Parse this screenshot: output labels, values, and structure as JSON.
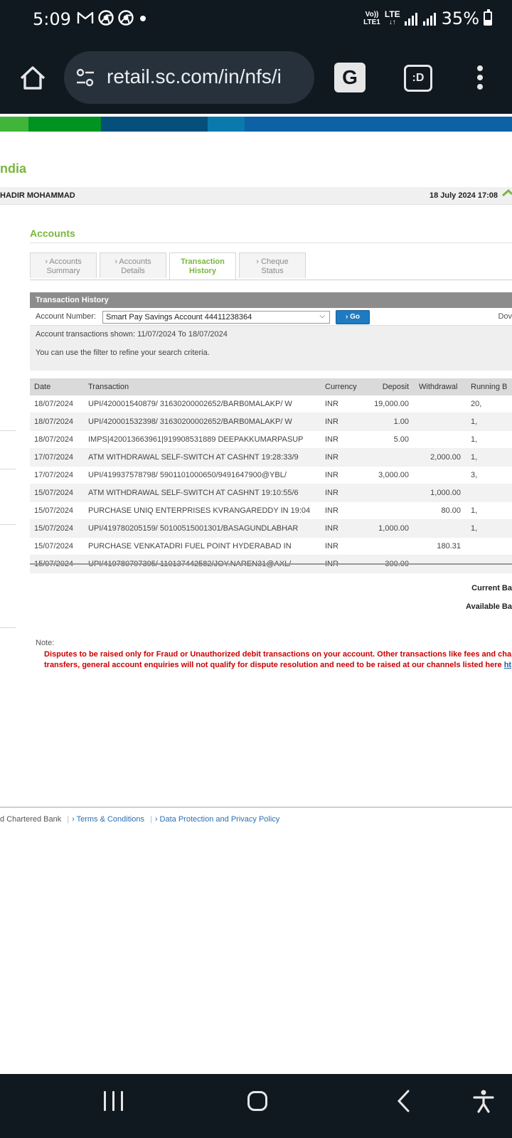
{
  "status_bar": {
    "time": "5:09",
    "network_top": "Vo))",
    "network_bottom": "LTE1",
    "lte_label": "LTE",
    "battery": "35%"
  },
  "browser": {
    "url": "retail.sc.com/in/nfs/i",
    "extension_label": ":D"
  },
  "colors": {
    "strip": [
      "#40b53a",
      "#009322",
      "#05507a",
      "#0a7aad",
      "#0c62a5"
    ],
    "accent_green": "#7ab63e",
    "note_red": "#cc0000"
  },
  "page": {
    "brand": "ndia",
    "user_name": "HADIR MOHAMMAD",
    "datetime": "18 July 2024 17:08",
    "section_title": "Accounts",
    "tabs": [
      {
        "line1": "› Accounts",
        "line2": "Summary"
      },
      {
        "line1": "› Accounts",
        "line2": "Details"
      },
      {
        "line1": "Transaction",
        "line2": "History"
      },
      {
        "line1": "› Cheque",
        "line2": "Status"
      }
    ],
    "panel_title": "Transaction History",
    "filter": {
      "account_label": "Account Number:",
      "account_value": "Smart Pay Savings Account 44411238364",
      "go_label": "› Go",
      "download_label": "Dov",
      "shown_text": "Account transactions shown: 11/07/2024 To 18/07/2024",
      "hint_text": "You can use the filter to refine your search criteria."
    },
    "table": {
      "headers": [
        "Date",
        "Transaction",
        "Currency",
        "Deposit",
        "Withdrawal",
        "Running B"
      ],
      "rows": [
        [
          "18/07/2024",
          "UPI/420001540879/ 31630200002652/BARB0MALAKP/ W",
          "INR",
          "19,000.00",
          "",
          "20,"
        ],
        [
          "18/07/2024",
          "UPI/420001532398/ 31630200002652/BARB0MALAKP/ W",
          "INR",
          "1.00",
          "",
          "1,"
        ],
        [
          "18/07/2024",
          "IMPS|420013663961|919908531889 DEEPAKKUMARPASUP",
          "INR",
          "5.00",
          "",
          "1,"
        ],
        [
          "17/07/2024",
          "ATM WITHDRAWAL SELF-SWITCH AT CASHNT 19:28:33/9",
          "INR",
          "",
          "2,000.00",
          "1,"
        ],
        [
          "17/07/2024",
          "UPI/419937578798/ 5901101000650/9491647900@YBL/",
          "INR",
          "3,000.00",
          "",
          "3,"
        ],
        [
          "15/07/2024",
          "ATM WITHDRAWAL SELF-SWITCH AT CASHNT 19:10:55/6",
          "INR",
          "",
          "1,000.00",
          ""
        ],
        [
          "15/07/2024",
          "PURCHASE UNIQ ENTERPRISES KVRANGAREDDY IN 19:04",
          "INR",
          "",
          "80.00",
          "1,"
        ],
        [
          "15/07/2024",
          "UPI/419780205159/ 50100515001301/BASAGUNDLABHAR",
          "INR",
          "1,000.00",
          "",
          "1,"
        ],
        [
          "15/07/2024",
          "PURCHASE VENKATADRI FUEL POINT HYDERABAD IN",
          "INR",
          "",
          "180.31",
          ""
        ],
        [
          "15/07/2024",
          "UPI/419780797395/ 110137442582/JOY.NAREN31@AXL/",
          "INR",
          "300.00",
          "",
          ""
        ]
      ]
    },
    "current_balance_label": "Current Ba",
    "available_balance_label": "Available Ba",
    "note_label": "Note:",
    "note_line1": "Disputes to be raised only for Fraud or Unauthorized debit transactions on your account. Other transactions like fees and cha",
    "note_line2": "transfers, general account enquiries will not qualify for dispute resolution and need to be raised at our channels listed here ",
    "note_link": "ht",
    "footer": {
      "bank": "d Chartered Bank",
      "terms": "› Terms & Conditions",
      "privacy": "› Data Protection and Privacy Policy"
    }
  }
}
